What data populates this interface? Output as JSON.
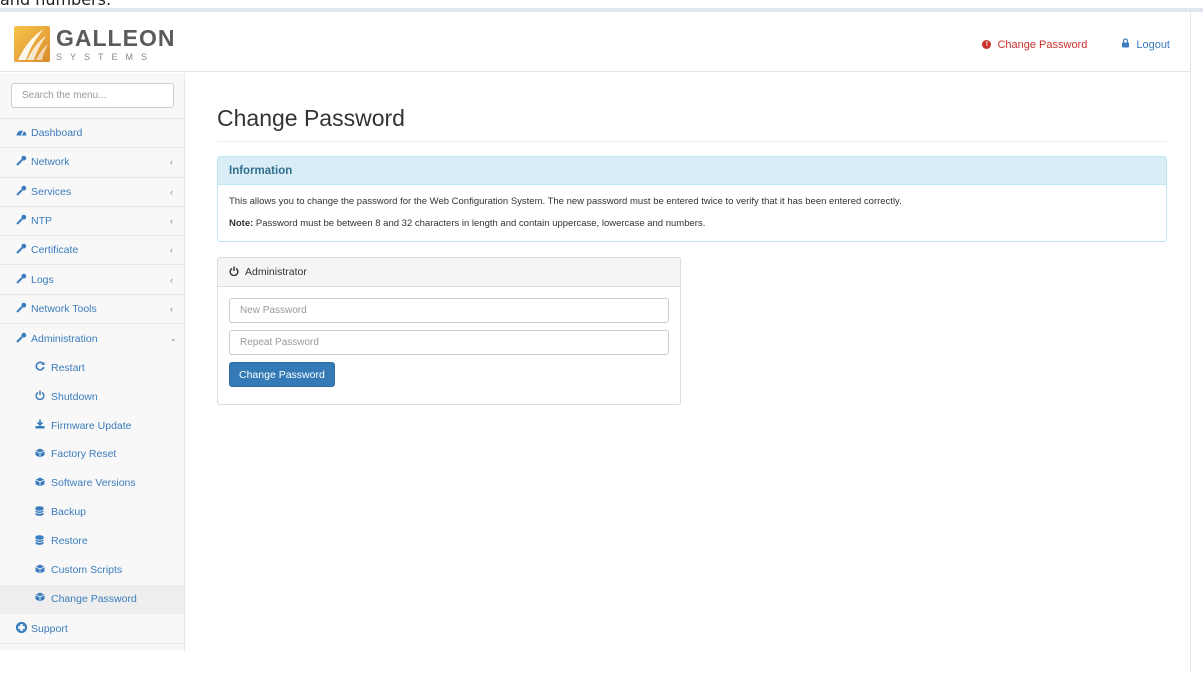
{
  "leak_text": "and numbers.",
  "header": {
    "logo_name": "GALLEON",
    "logo_sub": "SYSTEMS",
    "change_password_link": "Change Password",
    "logout_link": "Logout",
    "warn_color": "#c9302c",
    "link_color": "#3b7cbd"
  },
  "sidebar": {
    "search_placeholder": "Search the menu...",
    "items": [
      {
        "label": "Dashboard",
        "icon": "dashboard-icon"
      },
      {
        "label": "Network",
        "icon": "wrench-icon"
      },
      {
        "label": "Services",
        "icon": "wrench-icon"
      },
      {
        "label": "NTP",
        "icon": "wrench-icon"
      },
      {
        "label": "Certificate",
        "icon": "wrench-icon"
      },
      {
        "label": "Logs",
        "icon": "wrench-icon"
      },
      {
        "label": "Network Tools",
        "icon": "wrench-icon"
      },
      {
        "label": "Administration",
        "icon": "wrench-icon"
      }
    ],
    "admin_sub": [
      {
        "label": "Restart",
        "icon": "restart-icon"
      },
      {
        "label": "Shutdown",
        "icon": "power-icon"
      },
      {
        "label": "Firmware Update",
        "icon": "download-icon"
      },
      {
        "label": "Factory Reset",
        "icon": "cube-icon"
      },
      {
        "label": "Software Versions",
        "icon": "cube-icon"
      },
      {
        "label": "Backup",
        "icon": "database-icon"
      },
      {
        "label": "Restore",
        "icon": "database-icon"
      },
      {
        "label": "Custom Scripts",
        "icon": "cube-icon"
      },
      {
        "label": "Change Password",
        "icon": "cube-icon"
      }
    ],
    "support": {
      "label": "Support",
      "icon": "lifebuoy-icon"
    }
  },
  "main": {
    "title": "Change Password",
    "info": {
      "heading": "Information",
      "text": "This allows you to change the password for the Web Configuration System. The new password must be entered twice to verify that it has been entered correctly.",
      "note_label": "Note:",
      "note_text": " Password must be between 8 and 32 characters in length and contain uppercase, lowercase and numbers."
    },
    "admin": {
      "heading": "Administrator",
      "new_password_placeholder": "New Password",
      "repeat_password_placeholder": "Repeat Password",
      "submit_label": "Change Password"
    }
  }
}
